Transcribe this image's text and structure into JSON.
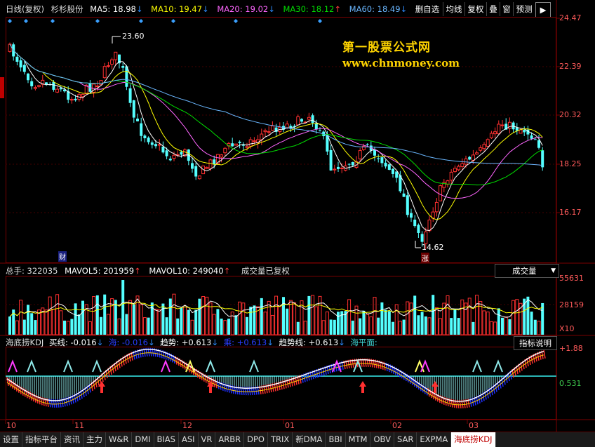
{
  "top_bar": {
    "period": "日线(复权)",
    "stock": "杉杉股份",
    "ma5": "MA5: 18.98",
    "ma10": "MA10: 19.47",
    "ma20": "MA20: 19.02",
    "ma30": "MA30: 18.12",
    "ma60": "MA60: 18.49",
    "buttons": [
      "删自选",
      "均线",
      "复权",
      "叠",
      "窗",
      "预测"
    ]
  },
  "watermark": {
    "line1": "第一股票公式网",
    "line2": "www.chnmoney.com"
  },
  "price_axis": [
    "24.47",
    "22.39",
    "20.32",
    "18.25",
    "16.17"
  ],
  "annotations": {
    "high": "23.60",
    "low": "14.62",
    "marker_cai": "财",
    "marker_zhang": "涨"
  },
  "volume_panel": {
    "total": "总手: 322035",
    "mavol5": "MAVOL5: 201959",
    "mavol10": "MAVOL10: 249040",
    "note": "成交量已复权",
    "dropdown": "成交量",
    "axis": [
      "55631",
      "28159",
      "X10"
    ]
  },
  "kdj_panel": {
    "name": "海底捞KDJ",
    "buy": "买线: -0.016",
    "hide1": "海: -0.016",
    "trend": "趋势: +0.613",
    "hide2": "乘: +0.613",
    "trendline": "趋势线: +0.613",
    "sea": "海平面:",
    "button": "指标说明",
    "axis": [
      "+1.88",
      "0.531"
    ]
  },
  "date_axis": [
    "10",
    "11",
    "12",
    "01",
    "02",
    "03"
  ],
  "bottom_tabs": [
    "设置",
    "指标平台",
    "资讯",
    "主力",
    "W&R",
    "DMI",
    "BIAS",
    "ASI",
    "VR",
    "ARBR",
    "DPO",
    "TRIX",
    "新DMA",
    "BBI",
    "MTM",
    "OBV",
    "SAR",
    "EXPMA",
    "海底捞KDJ"
  ],
  "colors": {
    "up": "#ff3030",
    "down": "#54ffff",
    "ma5": "#ffffff",
    "ma10": "#ffff00",
    "ma20": "#ff66ff",
    "ma30": "#00dd00",
    "ma60": "#6ab7ff"
  }
}
